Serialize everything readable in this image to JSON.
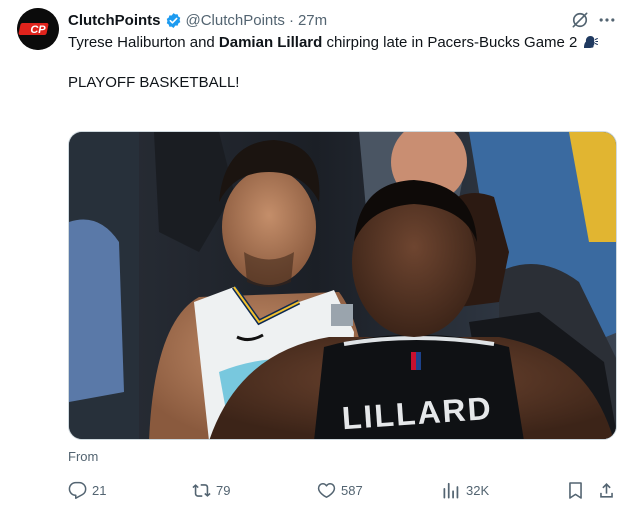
{
  "author": {
    "name": "ClutchPoints",
    "handle": "@ClutchPoints",
    "separator": "·",
    "time": "27m",
    "avatar_text": "CP",
    "verified_icon": "verified-badge-icon"
  },
  "tweet": {
    "text_part1": "Tyrese Haliburton and ",
    "text_bold": "Damian Lillard",
    "text_part2": " chirping late in Pacers-Bucks Game 2 ",
    "emoji": "speaking-head",
    "line2": "PLAYOFF BASKETBALL!"
  },
  "media": {
    "jersey_name": "LILLARD"
  },
  "from_label": "From",
  "actions": {
    "replies": "21",
    "reposts": "79",
    "likes": "587",
    "views": "32K"
  },
  "colors": {
    "accent": "#1d9bf0",
    "muted": "#536471",
    "text": "#0f1419",
    "brand_red": "#e0231c"
  }
}
